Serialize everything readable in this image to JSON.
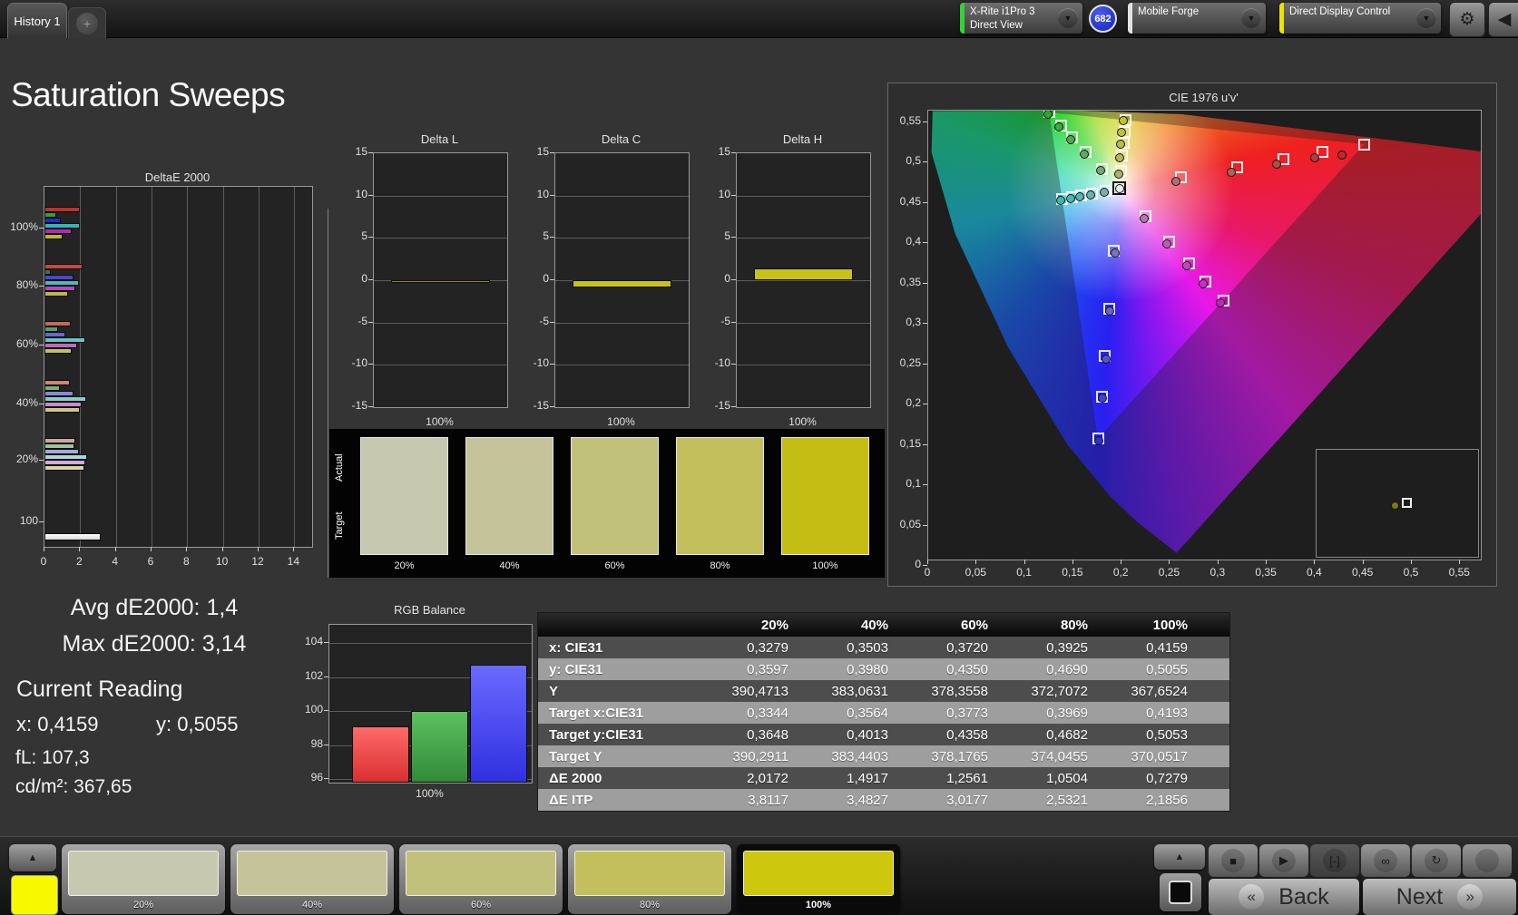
{
  "top_bar": {
    "tab_label": "History 1",
    "meter_device_line1": "X-Rite i1Pro 3",
    "meter_device_line2": "Direct View",
    "meter_badge": "682",
    "source_label": "Mobile Forge",
    "workflow_label": "Direct Display Control",
    "meter_stripe_color": "#35d435",
    "source_stripe_color": "#e2e2e2",
    "workflow_stripe_color": "#e8e400"
  },
  "icons": {
    "add_tab": "+",
    "chevron_down": "▼",
    "gear": "⚙",
    "collapse_left": "◀",
    "up_arrow": "▲",
    "stop": "■",
    "play": "▶",
    "loop_section": "[-]",
    "infinity": "∞",
    "refresh": "↻",
    "back_chevron": "«",
    "next_chevron": "»"
  },
  "page_title": "Saturation Sweeps",
  "stats": {
    "avg": "Avg dE2000: 1,4",
    "max": "Max dE2000: 3,14",
    "current_reading": "Current Reading",
    "x": "x: 0,4159",
    "y": "y: 0,5055",
    "fl": "fL: 107,3",
    "cd": "cd/m²: 367,65"
  },
  "chart_data": {
    "deltae2000": {
      "type": "bar",
      "title": "DeltaE 2000",
      "orientation": "horizontal-grouped",
      "x_ticks": [
        0,
        2,
        4,
        6,
        8,
        10,
        12,
        14
      ],
      "x_max": 15,
      "series_order": [
        "red",
        "green",
        "blue",
        "cyan",
        "magenta",
        "yellow"
      ],
      "groups": [
        {
          "label": "100%",
          "values": [
            2.0,
            0.65,
            0.9,
            2.0,
            1.5,
            1.0
          ],
          "colors": [
            "#c03028",
            "#28a828",
            "#2828cc",
            "#30b8b8",
            "#b828b8",
            "#c0b828"
          ]
        },
        {
          "label": "80%",
          "values": [
            2.15,
            0.35,
            1.6,
            1.95,
            1.75,
            1.3
          ],
          "colors": [
            "#c04c40",
            "#3a7a3a",
            "#4848cc",
            "#48bcbc",
            "#b848c0",
            "#c0b848"
          ]
        },
        {
          "label": "60%",
          "values": [
            1.45,
            0.75,
            1.15,
            2.3,
            1.85,
            1.5
          ],
          "colors": [
            "#c46858",
            "#58a058",
            "#6868d0",
            "#68c4c4",
            "#c068c4",
            "#c4c068"
          ]
        },
        {
          "label": "40%",
          "values": [
            1.4,
            0.85,
            1.6,
            2.35,
            2.1,
            2.0
          ],
          "colors": [
            "#c88878",
            "#78b078",
            "#8888d8",
            "#88cccc",
            "#cc88cc",
            "#ccc888"
          ]
        },
        {
          "label": "20%",
          "values": [
            1.75,
            1.65,
            1.95,
            2.4,
            2.3,
            2.25
          ],
          "colors": [
            "#cca89c",
            "#a0c0a0",
            "#a8a8dc",
            "#a8d8d8",
            "#d4a8d8",
            "#d8d4a8"
          ]
        },
        {
          "label": "100",
          "values": [
            3.14
          ],
          "colors": [
            "#ffffff"
          ]
        }
      ]
    },
    "delta_lch": {
      "type": "bar",
      "y_ticks": [
        15,
        10,
        5,
        0,
        -5,
        -10,
        -15
      ],
      "y_range": [
        -15,
        15
      ],
      "x_label": "100%",
      "charts": [
        {
          "title": "Delta L",
          "value": -0.3,
          "color": "#8f8f16"
        },
        {
          "title": "Delta C",
          "value": -0.8,
          "color": "#c8c11a"
        },
        {
          "title": "Delta H",
          "value": 1.4,
          "color": "#c8c11a"
        }
      ]
    },
    "cie": {
      "type": "scatter",
      "title": "CIE 1976 u'v'",
      "x_tick_labels": [
        "0",
        "0,05",
        "0,1",
        "0,15",
        "0,2",
        "0,25",
        "0,3",
        "0,35",
        "0,4",
        "0,45",
        "0,5",
        "0,55"
      ],
      "x_tick_values": [
        0,
        0.05,
        0.1,
        0.15,
        0.2,
        0.25,
        0.3,
        0.35,
        0.4,
        0.45,
        0.5,
        0.55
      ],
      "y_tick_labels": [
        "0",
        "0,05",
        "0,1",
        "0,15",
        "0,2",
        "0,25",
        "0,3",
        "0,35",
        "0,4",
        "0,45",
        "0,5",
        "0,55"
      ],
      "y_tick_values": [
        0,
        0.05,
        0.1,
        0.15,
        0.2,
        0.25,
        0.3,
        0.35,
        0.4,
        0.45,
        0.5,
        0.55
      ],
      "u_axis_max": 0.5713,
      "v_axis_top": 0.5646,
      "v_axis_bottom": 0.0084,
      "white_point": {
        "u": 0.1978,
        "v": 0.4683,
        "color": "#ececec"
      },
      "series": [
        {
          "name": "red",
          "point_colors": [
            "#b07070",
            "#b25f5f",
            "#b54b4b",
            "#b83a3a",
            "#bb2a2a"
          ],
          "targets": [
            [
              0.261,
              0.482
            ],
            [
              0.3192,
              0.4945
            ],
            [
              0.3672,
              0.5049
            ],
            [
              0.4077,
              0.5136
            ],
            [
              0.4507,
              0.5229
            ]
          ],
          "measured": [
            [
              0.256,
              0.477
            ],
            [
              0.313,
              0.488
            ],
            [
              0.36,
              0.498
            ],
            [
              0.4,
              0.506
            ],
            [
              0.428,
              0.51
            ]
          ]
        },
        {
          "name": "green",
          "point_colors": [
            "#74a874",
            "#62a862",
            "#50a850",
            "#3ea83e",
            "#2ca82c"
          ],
          "targets": [
            [
              0.1796,
              0.4919
            ],
            [
              0.1629,
              0.5135
            ],
            [
              0.149,
              0.5314
            ],
            [
              0.1374,
              0.5465
            ],
            [
              0.125,
              0.5625
            ]
          ],
          "measured": [
            [
              0.178,
              0.49
            ],
            [
              0.161,
              0.511
            ],
            [
              0.147,
              0.529
            ],
            [
              0.1355,
              0.544
            ],
            [
              0.124,
              0.56
            ]
          ]
        },
        {
          "name": "blue",
          "point_colors": [
            "#7878b8",
            "#6666c0",
            "#5454c8",
            "#4242d0",
            "#3030d8"
          ],
          "targets": [
            [
              0.1922,
              0.3907
            ],
            [
              0.187,
              0.3193
            ],
            [
              0.1828,
              0.2603
            ],
            [
              0.1792,
              0.2107
            ],
            [
              0.1754,
              0.1579
            ]
          ],
          "measured": [
            [
              0.193,
              0.388
            ],
            [
              0.188,
              0.316
            ],
            [
              0.184,
              0.257
            ],
            [
              0.18,
              0.208
            ],
            [
              0.176,
              0.156
            ]
          ]
        },
        {
          "name": "cyan",
          "point_colors": [
            "#78b0b0",
            "#68b2b2",
            "#58b5b5",
            "#48b8b8",
            "#38baba"
          ],
          "targets": [
            [
              0.183,
              0.4651
            ],
            [
              0.1693,
              0.4622
            ],
            [
              0.158,
              0.4597
            ],
            [
              0.1485,
              0.4577
            ],
            [
              0.1384,
              0.4555
            ]
          ],
          "measured": [
            [
              0.1815,
              0.463
            ],
            [
              0.168,
              0.46
            ],
            [
              0.1565,
              0.4575
            ],
            [
              0.147,
              0.4555
            ],
            [
              0.137,
              0.4535
            ]
          ]
        },
        {
          "name": "magenta",
          "point_colors": [
            "#b078b0",
            "#b562b5",
            "#ba4cba",
            "#c036c0",
            "#c520c5"
          ],
          "targets": [
            [
              0.2246,
              0.4337
            ],
            [
              0.2492,
              0.4018
            ],
            [
              0.2696,
              0.3755
            ],
            [
              0.2867,
              0.3533
            ],
            [
              0.3049,
              0.3298
            ]
          ],
          "measured": [
            [
              0.223,
              0.431
            ],
            [
              0.247,
              0.399
            ],
            [
              0.267,
              0.372
            ],
            [
              0.284,
              0.35
            ],
            [
              0.302,
              0.327
            ]
          ]
        },
        {
          "name": "yellow",
          "point_colors": [
            "#b0b070",
            "#b5b55e",
            "#baba4c",
            "#c0c03a",
            "#c5c528"
          ],
          "targets": [
            [
              0.1994,
              0.4894
            ],
            [
              0.2007,
              0.5085
            ],
            [
              0.2019,
              0.5247
            ],
            [
              0.2029,
              0.5385
            ],
            [
              0.2039,
              0.5529
            ]
          ],
          "measured": [
            [
              0.1969,
              0.4861
            ],
            [
              0.198,
              0.5062
            ],
            [
              0.199,
              0.5236
            ],
            [
              0.2002,
              0.5382
            ],
            [
              0.2021,
              0.5525
            ]
          ]
        }
      ],
      "inset": {
        "circle_color": "#7a7c10",
        "square_color": "#f0f0f0"
      }
    },
    "rgb_balance": {
      "type": "bar",
      "title": "RGB Balance",
      "categories": [
        "Red",
        "Green",
        "Blue"
      ],
      "values": [
        99.1,
        100.0,
        102.7
      ],
      "colors_top": [
        "#ff6a6a",
        "#5cc060",
        "#6a6aff"
      ],
      "colors_bottom": [
        "#d93030",
        "#338a38",
        "#3030e0"
      ],
      "y_ticks": [
        104,
        102,
        100,
        98,
        96
      ],
      "x_label": "100%"
    },
    "measurements_table": {
      "type": "table",
      "headers": [
        "",
        "20%",
        "40%",
        "60%",
        "80%",
        "100%"
      ],
      "rows": [
        {
          "label": "x: CIE31",
          "values": [
            "0,3279",
            "0,3503",
            "0,3720",
            "0,3925",
            "0,4159"
          ]
        },
        {
          "label": "y: CIE31",
          "values": [
            "0,3597",
            "0,3980",
            "0,4350",
            "0,4690",
            "0,5055"
          ]
        },
        {
          "label": "Y",
          "values": [
            "390,4713",
            "383,0631",
            "378,3558",
            "372,7072",
            "367,6524"
          ]
        },
        {
          "label": "Target x:CIE31",
          "values": [
            "0,3344",
            "0,3564",
            "0,3773",
            "0,3969",
            "0,4193"
          ]
        },
        {
          "label": "Target y:CIE31",
          "values": [
            "0,3648",
            "0,4013",
            "0,4358",
            "0,4682",
            "0,5053"
          ]
        },
        {
          "label": "Target Y",
          "values": [
            "390,2911",
            "383,4403",
            "378,1765",
            "374,0455",
            "370,0517"
          ]
        },
        {
          "label": "ΔE 2000",
          "values": [
            "2,0172",
            "1,4917",
            "1,2561",
            "1,0504",
            "0,7279"
          ]
        },
        {
          "label": "ΔE ITP",
          "values": [
            "3,8117",
            "3,4827",
            "3,0177",
            "2,5321",
            "2,1856"
          ]
        }
      ],
      "row_colors": [
        "#4d4d4d",
        "#9e9e9e"
      ]
    }
  },
  "swatch_strip": {
    "row_labels": [
      "Actual",
      "Target"
    ],
    "columns": [
      {
        "label": "20%",
        "color": "#c7c8b0"
      },
      {
        "label": "40%",
        "color": "#c4c399"
      },
      {
        "label": "60%",
        "color": "#c2c17c"
      },
      {
        "label": "80%",
        "color": "#c3bf5c"
      },
      {
        "label": "100%",
        "color": "#c4be14"
      }
    ]
  },
  "bottom_bar": {
    "mini_swatch_color": "#f8f800",
    "patches": [
      {
        "label": "20%",
        "color": "#c7c8b0",
        "selected": false
      },
      {
        "label": "40%",
        "color": "#c4c399",
        "selected": false
      },
      {
        "label": "60%",
        "color": "#c2c17c",
        "selected": false
      },
      {
        "label": "80%",
        "color": "#c3bf5c",
        "selected": false
      },
      {
        "label": "100%",
        "color": "#cdc70e",
        "selected": true
      }
    ],
    "media_buttons": [
      "stop",
      "play",
      "loop-section",
      "infinity",
      "refresh",
      "blank"
    ],
    "back_label": "Back",
    "next_label": "Next"
  }
}
